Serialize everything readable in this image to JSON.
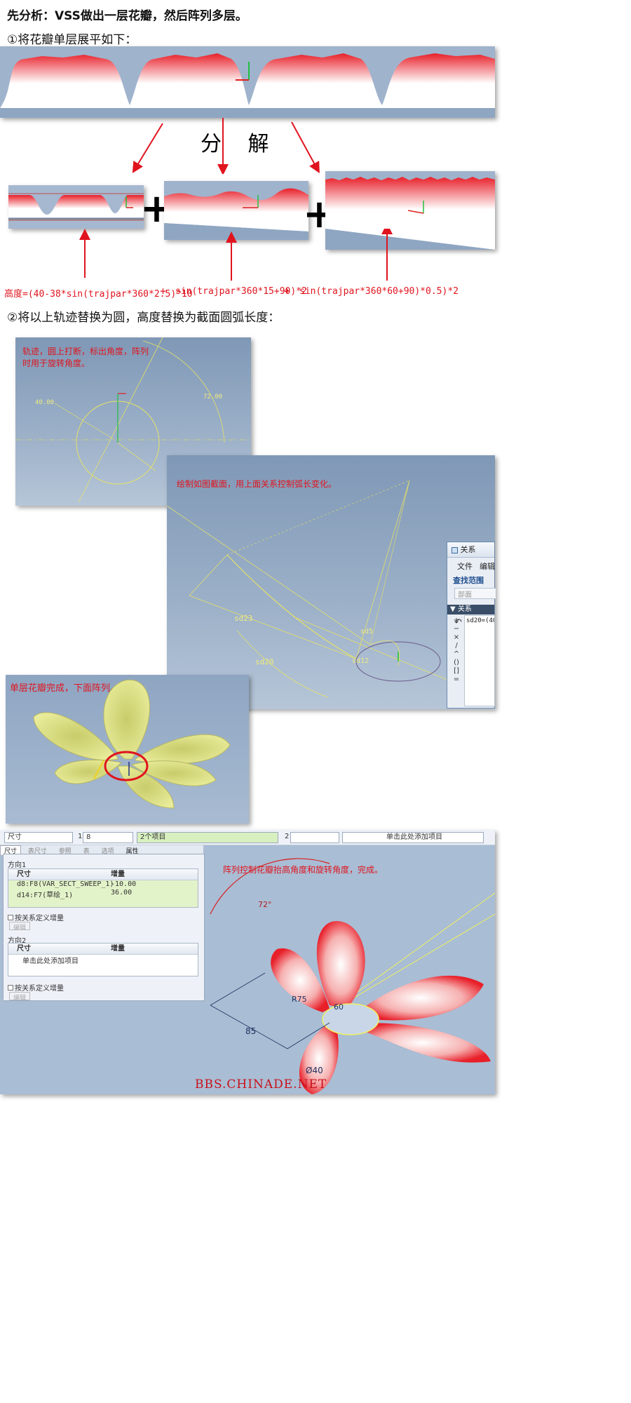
{
  "title": "先分析：VSS做出一层花瓣，然后阵列多层。",
  "step1": "①将花瓣单层展平如下：",
  "decompose": "分 解",
  "formula": {
    "part1": "高度=(40-38*sin(trajpar*360*2.5)^10",
    "plus": "+",
    "part2": "sin(trajpar*360*15+90)*2",
    "part3": "sin(trajpar*360*60+90)*0.5)*2"
  },
  "step2": "②将以上轨迹替换为圆，高度替换为截面圆弧长度：",
  "trajectory_note": "轨迹，圆上打断，标出角度，阵列时用于旋转角度。",
  "trajectory_dims": {
    "d1": "40.00",
    "d2": "72.00"
  },
  "section_note": "绘制如图截面，用上面关系控制弧长变化。",
  "section_dims": {
    "sd23": "sd23",
    "sd20": "sd20",
    "sd5": "sd5",
    "sd12": "sd12"
  },
  "relations_dialog": {
    "title": "关系",
    "menus": [
      "文件",
      "编辑"
    ],
    "search_scope": "查找范围",
    "scope_value": "部面",
    "section": "关系",
    "relation_text": "sd20=(40-3"
  },
  "single_layer_note": "单层花瓣完成，下面阵列。",
  "pattern_panel": {
    "type_select": "尺寸",
    "dir1_label": "1",
    "dir1_count": "8",
    "dir1_items": "2个项目",
    "dir2_label": "2",
    "dir2_count": "",
    "add_item": "单击此处添加项目",
    "tabs": [
      "尺寸",
      "表尺寸",
      "参照",
      "表",
      "选项",
      "属性"
    ],
    "direction1": "方向1",
    "direction2": "方向2",
    "col_dim": "尺寸",
    "col_inc": "增量",
    "rows": [
      {
        "dim": "d8:F8(VAR_SECT_SWEEP_1)",
        "inc": "-10.00"
      },
      {
        "dim": "d14:F7(草绘_1)",
        "inc": "36.00"
      }
    ],
    "dir2_placeholder": "单击此处添加项目",
    "relation_check": "按关系定义增量",
    "edit_button": "编辑"
  },
  "final_note": "阵列控制花瓣抬高角度和旋转角度，完成。",
  "final_dims": {
    "angle": "72°",
    "r": "R75",
    "d60": "60",
    "d85": "85",
    "dia": "Ø40"
  },
  "watermark": "BBS.CHINADE.NET",
  "colors": {
    "petal_red": "#e8202a",
    "cad_blue": "#8ea5c2",
    "note_red": "#e0141e",
    "petal_yellow": "#e9ec9a"
  }
}
